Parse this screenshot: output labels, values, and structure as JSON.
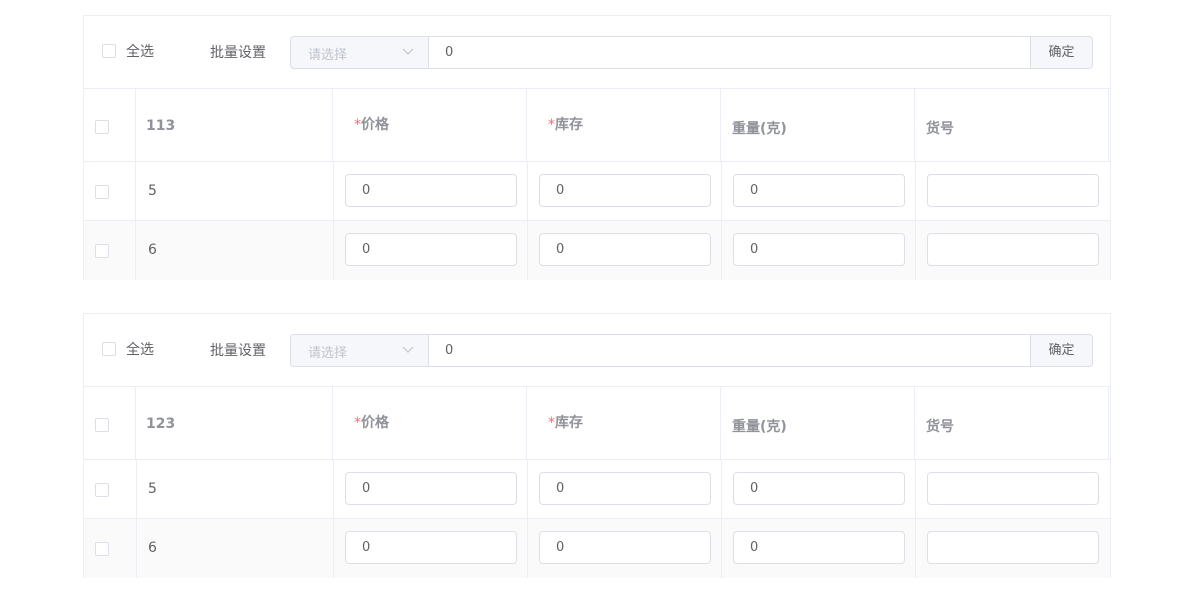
{
  "labels": {
    "select_all": "全选",
    "batch_set": "批量设置",
    "select_placeholder": "请选择",
    "confirm": "确定",
    "required_mark": "*",
    "col_price": "价格",
    "col_stock": "库存",
    "col_weight": "重量(克)",
    "col_sku": "货号"
  },
  "groups": [
    {
      "name": "113",
      "bulk_value": "0",
      "rows": [
        {
          "label": "5",
          "price": "0",
          "stock": "0",
          "weight": "0",
          "sku": ""
        },
        {
          "label": "6",
          "price": "0",
          "stock": "0",
          "weight": "0",
          "sku": ""
        }
      ]
    },
    {
      "name": "123",
      "bulk_value": "0",
      "rows": [
        {
          "label": "5",
          "price": "0",
          "stock": "0",
          "weight": "0",
          "sku": ""
        },
        {
          "label": "6",
          "price": "0",
          "stock": "0",
          "weight": "0",
          "sku": ""
        }
      ]
    }
  ]
}
